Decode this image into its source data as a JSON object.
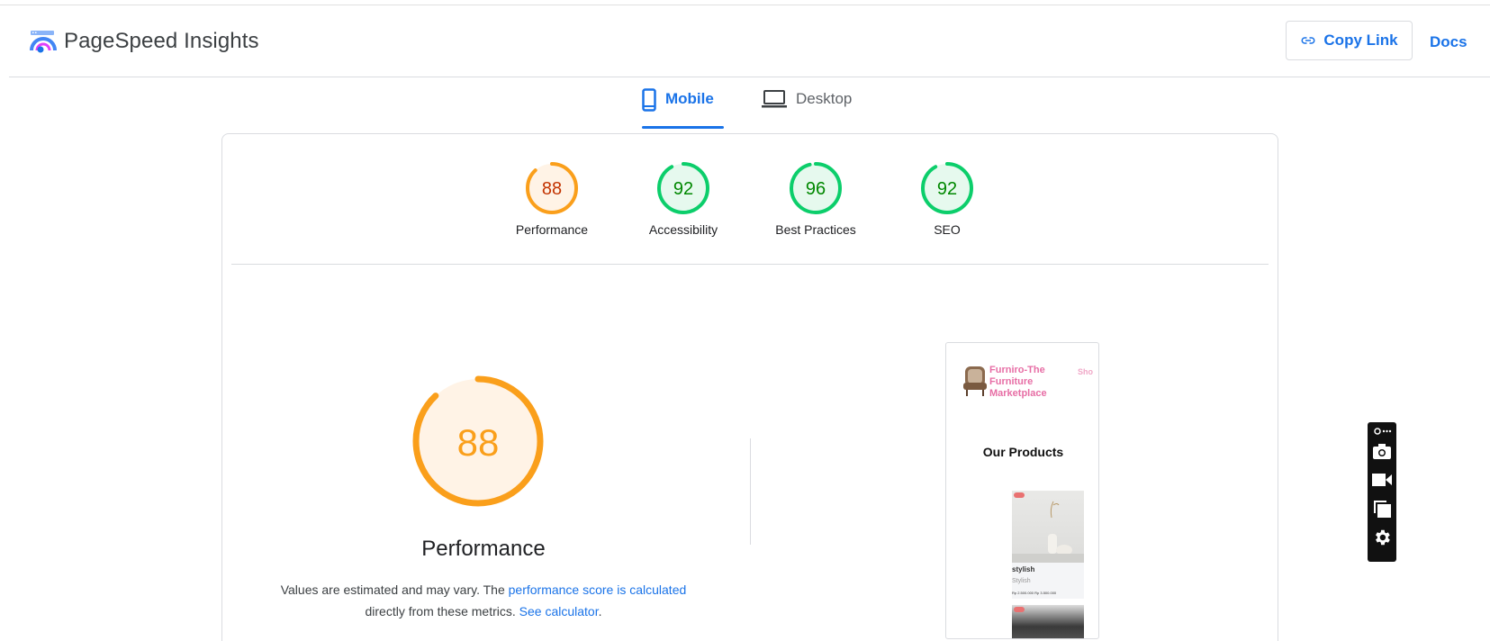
{
  "header": {
    "app_title": "PageSpeed Insights",
    "copy_link_label": "Copy Link",
    "docs_label": "Docs"
  },
  "tabs": [
    {
      "label": "Mobile",
      "selected": true
    },
    {
      "label": "Desktop",
      "selected": false
    }
  ],
  "scores": [
    {
      "label": "Performance",
      "value": "88",
      "status": "average"
    },
    {
      "label": "Accessibility",
      "value": "92",
      "status": "pass"
    },
    {
      "label": "Best Practices",
      "value": "96",
      "status": "pass"
    },
    {
      "label": "SEO",
      "value": "92",
      "status": "pass"
    }
  ],
  "performance_detail": {
    "score": "88",
    "title": "Performance",
    "desc_prefix": "Values are estimated and may vary. The ",
    "desc_link1": "performance score is calculated",
    "desc_middle": " directly from these metrics. ",
    "desc_link2": "See calculator",
    "desc_suffix": "."
  },
  "screenshot": {
    "brand": "Furniro-The Furniture Marketplace",
    "nav_partial": "Sho",
    "heading": "Our Products",
    "product_name": "stylish",
    "product_sub": "Stylish",
    "product_price": "Rp 2.500.000   Rp 3.500.000"
  },
  "colors": {
    "accent": "#1a73e8",
    "average": "#fa9f1b",
    "average_text": "#c33300",
    "pass": "#0cce6b",
    "pass_text": "#008800"
  },
  "icons": [
    "logo-icon",
    "link-icon",
    "phone-icon",
    "laptop-icon",
    "camera-icon",
    "video-icon",
    "copy-icon",
    "gear-icon"
  ]
}
